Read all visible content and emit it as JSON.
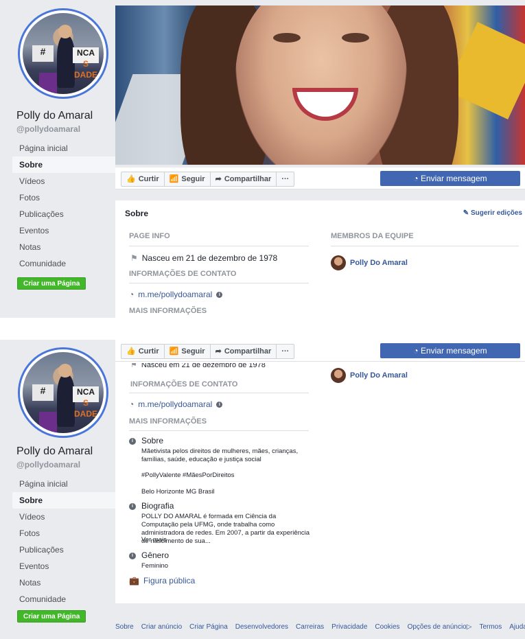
{
  "page": {
    "name": "Polly do Amaral",
    "handle": "@pollydoamaral"
  },
  "avatar": {
    "sign_left": "#",
    "sign_right_1": "NCA",
    "sign_right_2": "S DADE"
  },
  "nav": {
    "items": [
      "Página inicial",
      "Sobre",
      "Vídeos",
      "Fotos",
      "Publicações",
      "Eventos",
      "Notas",
      "Comunidade"
    ],
    "active": "Sobre"
  },
  "create_page_button": "Criar uma Página",
  "actions": {
    "like": "Curtir",
    "follow": "Seguir",
    "share": "Compartilhar",
    "more": "···",
    "send_message": "Enviar mensagem"
  },
  "about": {
    "title": "Sobre",
    "suggest_edits": "Sugerir edições",
    "page_info_heading": "PAGE INFO",
    "born": "Nasceu em 21 de dezembro de 1978",
    "contact_heading": "INFORMAÇÕES DE CONTATO",
    "messenger_link": "m.me/pollydoamaral",
    "more_info_heading": "MAIS INFORMAÇÕES",
    "team_heading": "MEMBROS DA EQUIPE",
    "team_member": "Polly Do Amaral"
  },
  "more_info": {
    "about_label": "Sobre",
    "about_text": "Mãetivista pelos direitos de mulheres, mães, crianças, famílias, saúde, educação e justiça social",
    "hashtags": "#PollyValente #MãesPorDireitos",
    "location": "Belo Horizonte MG Brasil",
    "bio_label": "Biografia",
    "bio_text": "POLLY DO AMARAL é formada em Ciência da Computação pela UFMG, onde trabalha como administradora de redes. Em 2007, a partir da experiência de nascimento de sua...",
    "see_more": "Ver mais",
    "gender_label": "Gênero",
    "gender_value": "Feminino",
    "category": "Figura pública"
  },
  "footer": [
    "Sobre",
    "Criar anúncio",
    "Criar Página",
    "Desenvolvedores",
    "Carreiras",
    "Privacidade",
    "Cookies",
    "Opções de anúncio",
    "Termos",
    "Ajuda"
  ],
  "colors": {
    "brand_blue": "#4267b2",
    "link_blue": "#365899",
    "green": "#42b72a",
    "avatar_ring": "#4a76d9"
  }
}
